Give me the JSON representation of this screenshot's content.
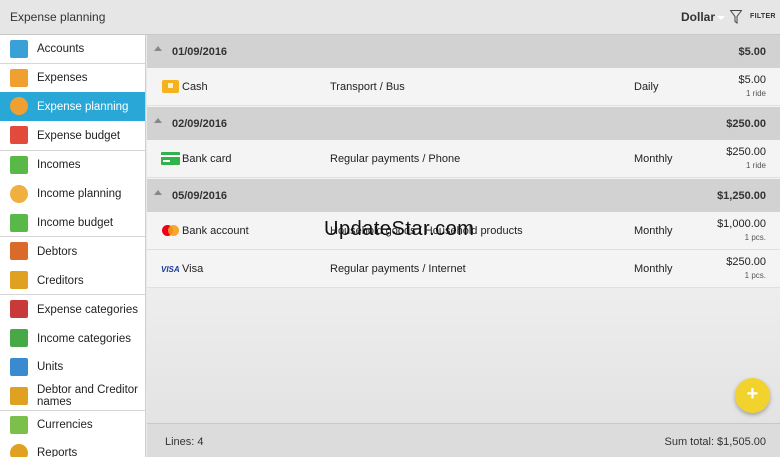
{
  "app": {
    "title": "Expense planning"
  },
  "toolbar": {
    "currency": "Dollar",
    "filter_label": "FILTER"
  },
  "sidebar": {
    "items": [
      {
        "label": "Accounts",
        "icon": "accounts-icon",
        "color": "#3aa0d8"
      },
      {
        "label": "Expenses",
        "icon": "expenses-icon",
        "color": "#e24b3b"
      },
      {
        "label": "Expense planning",
        "icon": "expense-planning-icon",
        "color": "#f0a030"
      },
      {
        "label": "Expense budget",
        "icon": "expense-budget-icon",
        "color": "#e24b3b"
      },
      {
        "label": "Incomes",
        "icon": "incomes-icon",
        "color": "#58b848"
      },
      {
        "label": "Income planning",
        "icon": "income-planning-icon",
        "color": "#58b848"
      },
      {
        "label": "Income budget",
        "icon": "income-budget-icon",
        "color": "#58b848"
      },
      {
        "label": "Debtors",
        "icon": "debtors-icon",
        "color": "#d96a2a"
      },
      {
        "label": "Creditors",
        "icon": "creditors-icon",
        "color": "#e0a020"
      },
      {
        "label": "Expense categories",
        "icon": "expense-categories-icon",
        "color": "#c83a3a"
      },
      {
        "label": "Income categories",
        "icon": "income-categories-icon",
        "color": "#48a848"
      },
      {
        "label": "Units",
        "icon": "units-icon",
        "color": "#3a8ad0"
      },
      {
        "label": "Debtor and Creditor names",
        "icon": "debtor-creditor-names-icon",
        "color": "#e0a020"
      },
      {
        "label": "Currencies",
        "icon": "currencies-icon",
        "color": "#7ac04a"
      },
      {
        "label": "Reports",
        "icon": "reports-icon",
        "color": "#e0a020"
      }
    ],
    "active_index": 2
  },
  "groups": [
    {
      "date": "01/09/2016",
      "total": "$5.00",
      "rows": [
        {
          "account": "Cash",
          "account_icon": "cash-icon",
          "category": "Transport / Bus",
          "period": "Daily",
          "amount": "$5.00",
          "qty": "1 ride"
        }
      ]
    },
    {
      "date": "02/09/2016",
      "total": "$250.00",
      "rows": [
        {
          "account": "Bank card",
          "account_icon": "bank-card-icon",
          "category": "Regular payments / Phone",
          "period": "Monthly",
          "amount": "$250.00",
          "qty": "1 ride"
        }
      ]
    },
    {
      "date": "05/09/2016",
      "total": "$1,250.00",
      "rows": [
        {
          "account": "Bank account",
          "account_icon": "mastercard-icon",
          "category": "Household goods / Household products",
          "period": "Monthly",
          "amount": "$1,000.00",
          "qty": "1 pcs."
        },
        {
          "account": "Visa",
          "account_icon": "visa-icon",
          "category": "Regular payments / Internet",
          "period": "Monthly",
          "amount": "$250.00",
          "qty": "1 pcs."
        }
      ]
    }
  ],
  "watermark": "UpdateStar.com",
  "fab": {
    "label": "+"
  },
  "footer": {
    "lines": "Lines: 4",
    "sum_total": "Sum total: $1,505.00"
  },
  "colors": {
    "accent": "#29a8d8",
    "fab": "#f2d32e",
    "group_header": "#d2d2d2"
  }
}
